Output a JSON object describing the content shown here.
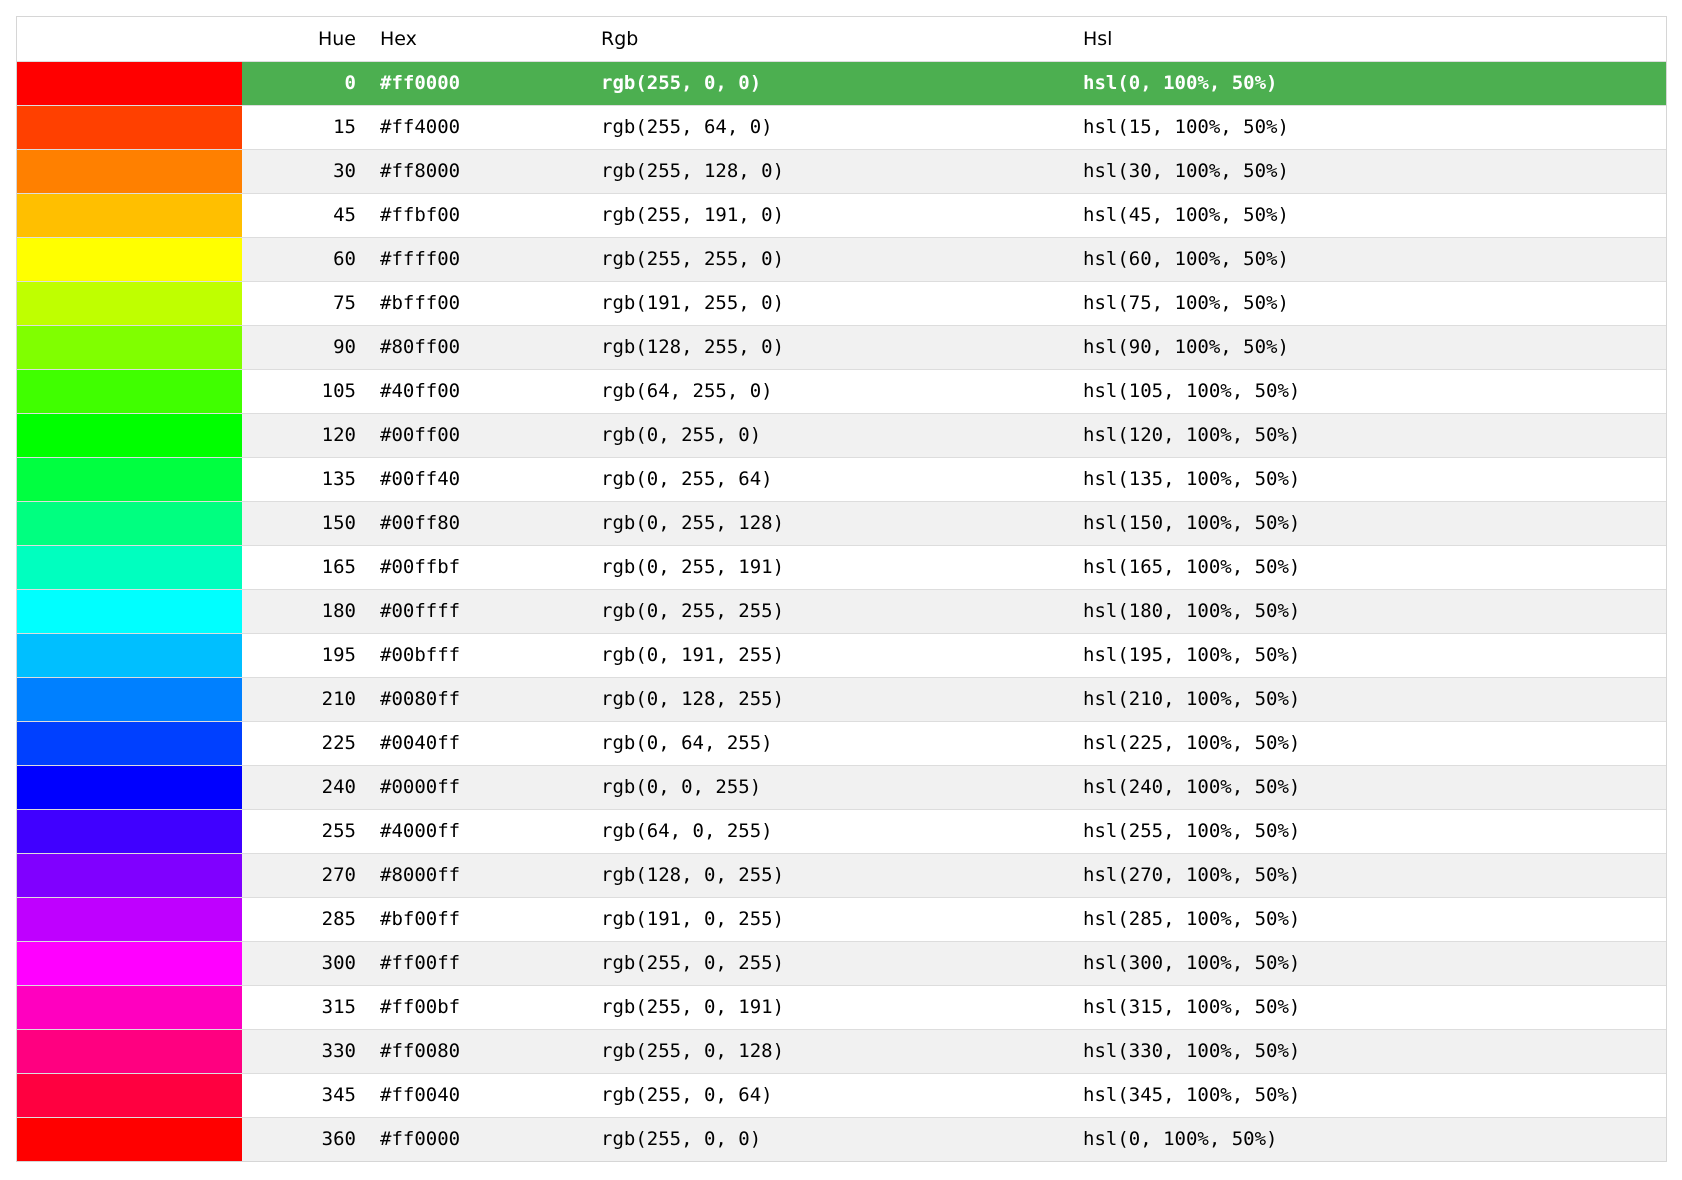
{
  "headers": {
    "swatch": "",
    "hue": "Hue",
    "hex": "Hex",
    "rgb": "Rgb",
    "hsl": "Hsl"
  },
  "accent_color": "#4caf50",
  "selected_index": 0,
  "rows": [
    {
      "hue": "0",
      "hex": "#ff0000",
      "rgb": "rgb(255, 0, 0)",
      "hsl": "hsl(0, 100%, 50%)",
      "color": "#ff0000"
    },
    {
      "hue": "15",
      "hex": "#ff4000",
      "rgb": "rgb(255, 64, 0)",
      "hsl": "hsl(15, 100%, 50%)",
      "color": "#ff4000"
    },
    {
      "hue": "30",
      "hex": "#ff8000",
      "rgb": "rgb(255, 128, 0)",
      "hsl": "hsl(30, 100%, 50%)",
      "color": "#ff8000"
    },
    {
      "hue": "45",
      "hex": "#ffbf00",
      "rgb": "rgb(255, 191, 0)",
      "hsl": "hsl(45, 100%, 50%)",
      "color": "#ffbf00"
    },
    {
      "hue": "60",
      "hex": "#ffff00",
      "rgb": "rgb(255, 255, 0)",
      "hsl": "hsl(60, 100%, 50%)",
      "color": "#ffff00"
    },
    {
      "hue": "75",
      "hex": "#bfff00",
      "rgb": "rgb(191, 255, 0)",
      "hsl": "hsl(75, 100%, 50%)",
      "color": "#bfff00"
    },
    {
      "hue": "90",
      "hex": "#80ff00",
      "rgb": "rgb(128, 255, 0)",
      "hsl": "hsl(90, 100%, 50%)",
      "color": "#80ff00"
    },
    {
      "hue": "105",
      "hex": "#40ff00",
      "rgb": "rgb(64, 255, 0)",
      "hsl": "hsl(105, 100%, 50%)",
      "color": "#40ff00"
    },
    {
      "hue": "120",
      "hex": "#00ff00",
      "rgb": "rgb(0, 255, 0)",
      "hsl": "hsl(120, 100%, 50%)",
      "color": "#00ff00"
    },
    {
      "hue": "135",
      "hex": "#00ff40",
      "rgb": "rgb(0, 255, 64)",
      "hsl": "hsl(135, 100%, 50%)",
      "color": "#00ff40"
    },
    {
      "hue": "150",
      "hex": "#00ff80",
      "rgb": "rgb(0, 255, 128)",
      "hsl": "hsl(150, 100%, 50%)",
      "color": "#00ff80"
    },
    {
      "hue": "165",
      "hex": "#00ffbf",
      "rgb": "rgb(0, 255, 191)",
      "hsl": "hsl(165, 100%, 50%)",
      "color": "#00ffbf"
    },
    {
      "hue": "180",
      "hex": "#00ffff",
      "rgb": "rgb(0, 255, 255)",
      "hsl": "hsl(180, 100%, 50%)",
      "color": "#00ffff"
    },
    {
      "hue": "195",
      "hex": "#00bfff",
      "rgb": "rgb(0, 191, 255)",
      "hsl": "hsl(195, 100%, 50%)",
      "color": "#00bfff"
    },
    {
      "hue": "210",
      "hex": "#0080ff",
      "rgb": "rgb(0, 128, 255)",
      "hsl": "hsl(210, 100%, 50%)",
      "color": "#0080ff"
    },
    {
      "hue": "225",
      "hex": "#0040ff",
      "rgb": "rgb(0, 64, 255)",
      "hsl": "hsl(225, 100%, 50%)",
      "color": "#0040ff"
    },
    {
      "hue": "240",
      "hex": "#0000ff",
      "rgb": "rgb(0, 0, 255)",
      "hsl": "hsl(240, 100%, 50%)",
      "color": "#0000ff"
    },
    {
      "hue": "255",
      "hex": "#4000ff",
      "rgb": "rgb(64, 0, 255)",
      "hsl": "hsl(255, 100%, 50%)",
      "color": "#4000ff"
    },
    {
      "hue": "270",
      "hex": "#8000ff",
      "rgb": "rgb(128, 0, 255)",
      "hsl": "hsl(270, 100%, 50%)",
      "color": "#8000ff"
    },
    {
      "hue": "285",
      "hex": "#bf00ff",
      "rgb": "rgb(191, 0, 255)",
      "hsl": "hsl(285, 100%, 50%)",
      "color": "#bf00ff"
    },
    {
      "hue": "300",
      "hex": "#ff00ff",
      "rgb": "rgb(255, 0, 255)",
      "hsl": "hsl(300, 100%, 50%)",
      "color": "#ff00ff"
    },
    {
      "hue": "315",
      "hex": "#ff00bf",
      "rgb": "rgb(255, 0, 191)",
      "hsl": "hsl(315, 100%, 50%)",
      "color": "#ff00bf"
    },
    {
      "hue": "330",
      "hex": "#ff0080",
      "rgb": "rgb(255, 0, 128)",
      "hsl": "hsl(330, 100%, 50%)",
      "color": "#ff0080"
    },
    {
      "hue": "345",
      "hex": "#ff0040",
      "rgb": "rgb(255, 0, 64)",
      "hsl": "hsl(345, 100%, 50%)",
      "color": "#ff0040"
    },
    {
      "hue": "360",
      "hex": "#ff0000",
      "rgb": "rgb(255, 0, 0)",
      "hsl": "hsl(0, 100%, 50%)",
      "color": "#ff0000"
    }
  ]
}
